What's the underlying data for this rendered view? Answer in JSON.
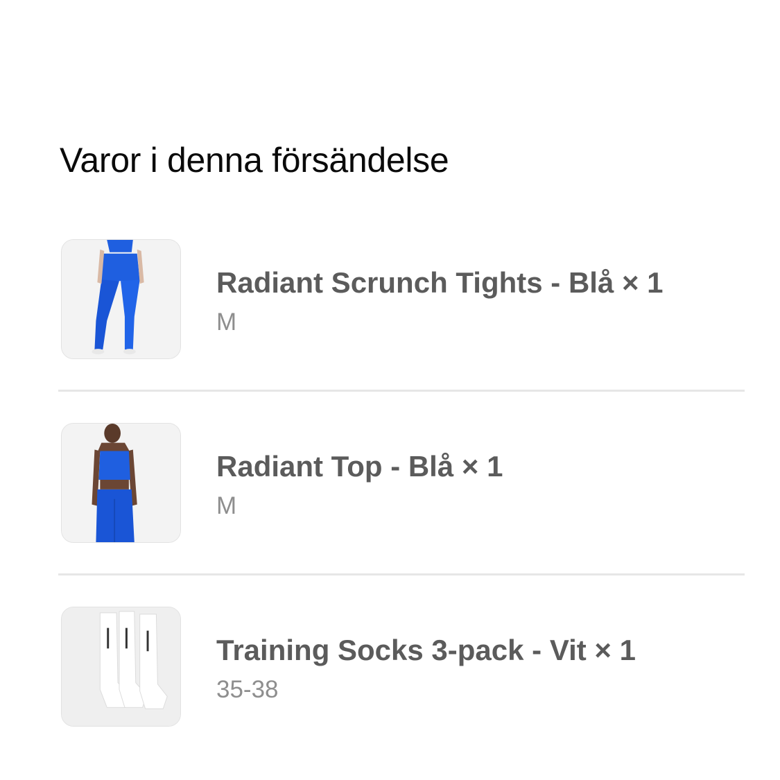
{
  "section": {
    "title": "Varor i denna försändelse"
  },
  "items": [
    {
      "name": "Radiant Scrunch Tights - Blå × 1",
      "variant": "M",
      "image": "blue-tights-product-image",
      "color": "#1f5fe0"
    },
    {
      "name": "Radiant Top - Blå × 1",
      "variant": "M",
      "image": "blue-sports-top-product-image",
      "color": "#1f5fe0"
    },
    {
      "name": "Training Socks 3-pack - Vit × 1",
      "variant": "35-38",
      "image": "white-socks-product-image",
      "color": "#ffffff"
    }
  ]
}
